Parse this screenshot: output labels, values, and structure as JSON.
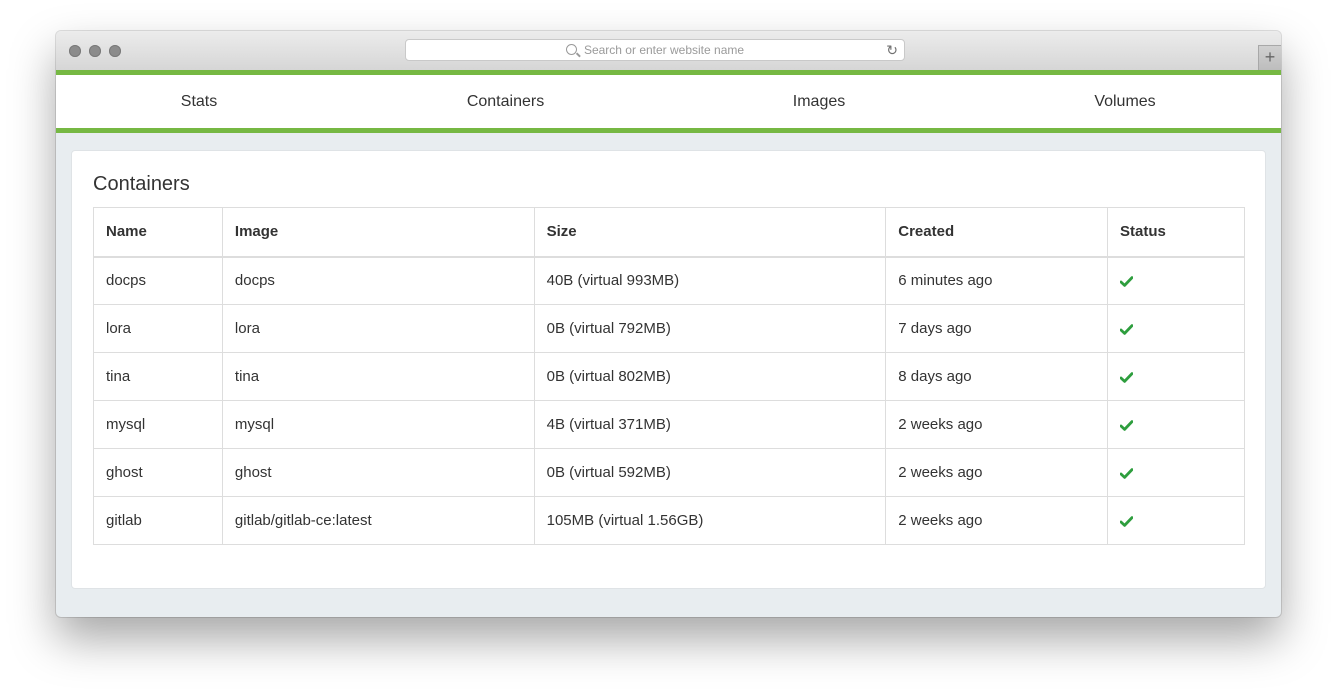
{
  "browser": {
    "url_placeholder": "Search or enter website name"
  },
  "nav": {
    "items": [
      {
        "label": "Stats"
      },
      {
        "label": "Containers"
      },
      {
        "label": "Images"
      },
      {
        "label": "Volumes"
      }
    ]
  },
  "panel": {
    "title": "Containers",
    "columns": [
      "Name",
      "Image",
      "Size",
      "Created",
      "Status"
    ],
    "rows": [
      {
        "name": "docps",
        "image": "docps",
        "size": "40B (virtual 993MB)",
        "created": "6 minutes ago",
        "status": "running"
      },
      {
        "name": "lora",
        "image": "lora",
        "size": "0B (virtual 792MB)",
        "created": "7 days ago",
        "status": "running"
      },
      {
        "name": "tina",
        "image": "tina",
        "size": "0B (virtual 802MB)",
        "created": "8 days ago",
        "status": "running"
      },
      {
        "name": "mysql",
        "image": "mysql",
        "size": "4B (virtual 371MB)",
        "created": "2 weeks ago",
        "status": "running"
      },
      {
        "name": "ghost",
        "image": "ghost",
        "size": "0B (virtual 592MB)",
        "created": "2 weeks ago",
        "status": "running"
      },
      {
        "name": "gitlab",
        "image": "gitlab/gitlab-ce:latest",
        "size": "105MB (virtual 1.56GB)",
        "created": "2 weeks ago",
        "status": "running"
      }
    ]
  },
  "colors": {
    "accent": "#76b843",
    "status_ok": "#2e9e3e"
  },
  "icons": {
    "status": "check-icon"
  }
}
